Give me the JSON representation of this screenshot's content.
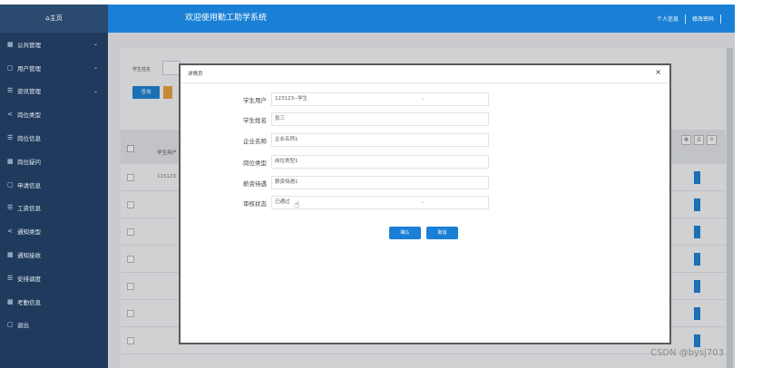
{
  "sidebar": {
    "home": "主页",
    "items": [
      {
        "icon": "grid",
        "label": "公共管理",
        "expandable": true
      },
      {
        "icon": "square",
        "label": "用户管理",
        "expandable": true
      },
      {
        "icon": "list",
        "label": "资讯管理",
        "expandable": true
      },
      {
        "icon": "share",
        "label": "岗位类型",
        "expandable": false
      },
      {
        "icon": "list",
        "label": "岗位信息",
        "expandable": false
      },
      {
        "icon": "grid",
        "label": "岗位疑问",
        "expandable": false
      },
      {
        "icon": "square",
        "label": "申请信息",
        "expandable": false
      },
      {
        "icon": "list",
        "label": "工资信息",
        "expandable": false
      },
      {
        "icon": "share",
        "label": "通知类型",
        "expandable": false
      },
      {
        "icon": "grid",
        "label": "通知接收",
        "expandable": false
      },
      {
        "icon": "list",
        "label": "安排调度",
        "expandable": false
      },
      {
        "icon": "grid",
        "label": "考勤信息",
        "expandable": false
      },
      {
        "icon": "square",
        "label": "退出",
        "expandable": false
      }
    ]
  },
  "header": {
    "title": "欢迎使用勤工助学系统",
    "links": [
      "个人信息",
      "修改密码"
    ]
  },
  "background": {
    "filter_label": "学生姓名",
    "query_button": "查询",
    "column_head": "学生用户",
    "row_value": "123123",
    "toolbar_icons": [
      "grid-icon",
      "print-icon",
      "export-icon"
    ]
  },
  "dialog": {
    "title": "详情页",
    "close": "×",
    "fields": [
      {
        "label": "学生用户",
        "value": "123123--学生",
        "type": "select"
      },
      {
        "label": "学生姓名",
        "value": "张三",
        "type": "text"
      },
      {
        "label": "企业名称",
        "value": "企业名称1",
        "type": "text"
      },
      {
        "label": "岗位类型",
        "value": "岗位类型1",
        "type": "text"
      },
      {
        "label": "薪资待遇",
        "value": "薪资待遇1",
        "type": "text"
      },
      {
        "label": "审核状态",
        "value": "已通过",
        "type": "select"
      }
    ],
    "confirm_label": "确认",
    "cancel_label": "取消"
  },
  "watermark": "CSDN @bysj703",
  "colors": {
    "sidebar": "#1f3a5c",
    "header": "#1980d5",
    "primary": "#1980d5"
  }
}
